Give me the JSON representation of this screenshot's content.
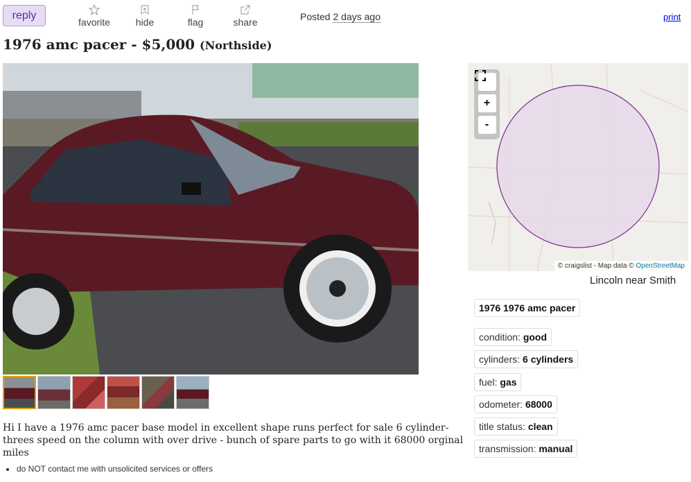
{
  "toolbar": {
    "reply": "reply",
    "favorite": "favorite",
    "hide": "hide",
    "flag": "flag",
    "share": "share",
    "posted_label": "Posted",
    "posted_ago": "2 days ago",
    "print": "print"
  },
  "posting": {
    "title": "1976 amc pacer",
    "separator": "-",
    "price": "$5,000",
    "location": "(Northside)"
  },
  "description": "Hi I have a 1976 amc pacer base model in excellent shape runs perfect for sale 6 cylinder- threes speed on the column with over drive - bunch of spare parts to go with it 68000 orginal miles",
  "notice": "do NOT contact me with unsolicited services or offers",
  "map": {
    "fullscreen": "⛶",
    "zoom_in": "+",
    "zoom_out": "-",
    "attribution_prefix": "© craigslist - Map data ©",
    "attribution_link": "OpenStreetMap",
    "caption": "Lincoln near Smith",
    "circle_color": "#e6d8ea",
    "circle_stroke": "#7a2a8a"
  },
  "attributes": {
    "heading": "1976 1976 amc pacer",
    "condition_label": "condition:",
    "condition_value": "good",
    "cylinders_label": "cylinders:",
    "cylinders_value": "6 cylinders",
    "fuel_label": "fuel:",
    "fuel_value": "gas",
    "odometer_label": "odometer:",
    "odometer_value": "68000",
    "title_status_label": "title status:",
    "title_status_value": "clean",
    "transmission_label": "transmission:",
    "transmission_value": "manual"
  },
  "colors": {
    "car_body": "#5a1a24",
    "reply_bg": "#e6dcf4",
    "link": "#0000ee"
  },
  "thumbnails": [
    {
      "selected": true
    },
    {
      "selected": false
    },
    {
      "selected": false
    },
    {
      "selected": false
    },
    {
      "selected": false
    },
    {
      "selected": false
    }
  ]
}
